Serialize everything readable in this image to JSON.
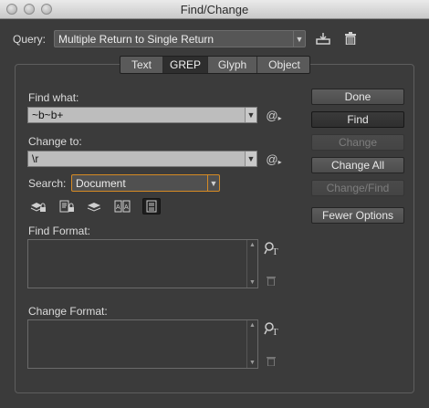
{
  "window": {
    "title": "Find/Change"
  },
  "query": {
    "label": "Query:",
    "selected": "Multiple Return to Single Return",
    "save_icon": "save-query-icon",
    "delete_icon": "trash-icon"
  },
  "tabs": [
    {
      "label": "Text",
      "active": false
    },
    {
      "label": "GREP",
      "active": true
    },
    {
      "label": "Glyph",
      "active": false
    },
    {
      "label": "Object",
      "active": false
    }
  ],
  "find_what": {
    "label": "Find what:",
    "value": "~b~b+"
  },
  "change_to": {
    "label": "Change to:",
    "value": "\\r"
  },
  "search": {
    "label": "Search:",
    "selected": "Document"
  },
  "find_format": {
    "label": "Find Format:"
  },
  "change_format": {
    "label": "Change Format:"
  },
  "buttons": {
    "done": "Done",
    "find": "Find",
    "change": "Change",
    "change_all": "Change All",
    "change_find": "Change/Find",
    "fewer_options": "Fewer Options"
  },
  "search_option_icons": [
    "locked-layers-icon",
    "locked-stories-icon",
    "hidden-layers-icon",
    "master-pages-icon",
    "footnotes-icon"
  ]
}
